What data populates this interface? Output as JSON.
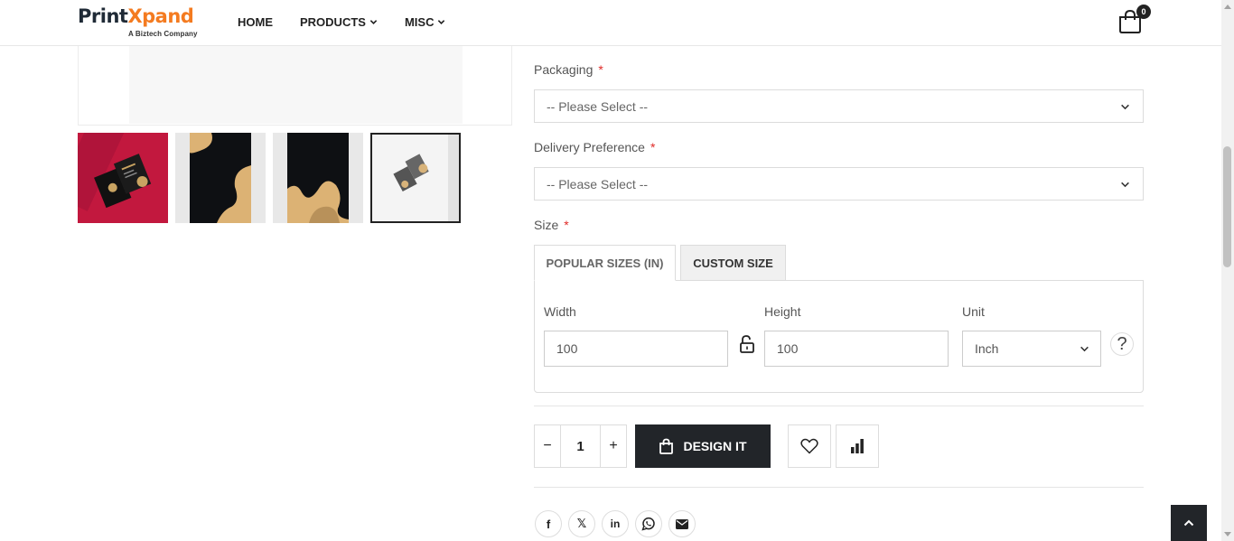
{
  "brand": {
    "name_part1": "Print",
    "name_part2": "Xpand",
    "tagline": "A Biztech Company",
    "accent": "#f47b20"
  },
  "nav": [
    {
      "label": "HOME"
    },
    {
      "label": "PRODUCTS"
    },
    {
      "label": "MISC"
    }
  ],
  "cart": {
    "count": "0",
    "icon": "shopping-bag-icon"
  },
  "gallery": {
    "thumbnails": [
      {
        "name": "business-cards-red-background"
      },
      {
        "name": "black-gold-wave-card-front"
      },
      {
        "name": "black-gold-wave-card-back"
      },
      {
        "name": "cards-mockup-white",
        "selected": true
      }
    ]
  },
  "form": {
    "packaging": {
      "label": "Packaging",
      "required": "*",
      "value": "-- Please Select --"
    },
    "delivery": {
      "label": "Delivery Preference",
      "required": "*",
      "value": "-- Please Select --"
    },
    "size": {
      "label": "Size",
      "required": "*",
      "tabs": [
        {
          "label": "POPULAR SIZES (IN)"
        },
        {
          "label": "CUSTOM SIZE",
          "active": true
        }
      ],
      "width": {
        "label": "Width",
        "value": "100"
      },
      "height": {
        "label": "Height",
        "value": "100"
      },
      "unit": {
        "label": "Unit",
        "value": "Inch"
      },
      "help": "?"
    }
  },
  "purchase": {
    "quantity": "1",
    "minus": "−",
    "plus": "+",
    "design_button": "DESIGN IT"
  },
  "share": [
    {
      "icon": "facebook-icon",
      "glyph": "f"
    },
    {
      "icon": "x-twitter-icon",
      "glyph": "𝕏"
    },
    {
      "icon": "linkedin-icon",
      "glyph": "in"
    },
    {
      "icon": "whatsapp-icon",
      "glyph": ""
    },
    {
      "icon": "email-icon",
      "glyph": ""
    }
  ],
  "colors": {
    "dark": "#222529",
    "required": "#e02b27",
    "border": "#dcdcdc"
  }
}
